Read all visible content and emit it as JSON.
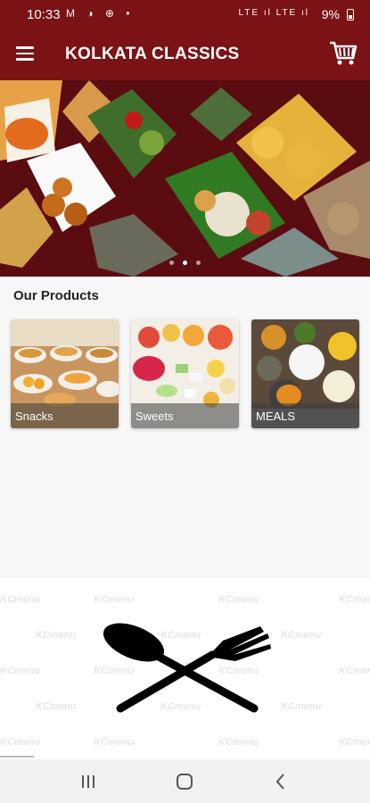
{
  "status_bar": {
    "time": "10:33",
    "left_icons": "M ◑ ⊕ •",
    "right_icons": "LTE ıl LTE ıl",
    "battery": "9%"
  },
  "app_bar": {
    "title": "KOLKATA CLASSICS"
  },
  "banner": {
    "slides": 3,
    "active_slide": 1
  },
  "products": {
    "heading": "Our Products",
    "items": [
      {
        "label": "Snacks"
      },
      {
        "label": "Sweets"
      },
      {
        "label": "MEALS"
      }
    ]
  },
  "watermark_text": "KCmenu",
  "colors": {
    "primary": "#7a1216",
    "banner_bg": "#5a0c10",
    "page_bg": "#f7f7f7"
  },
  "icons": {
    "menu": "hamburger-icon",
    "cart": "cart-icon",
    "recent": "recent-apps-icon",
    "home": "home-icon",
    "back": "back-icon",
    "footer": "spoon-fork-icon"
  }
}
